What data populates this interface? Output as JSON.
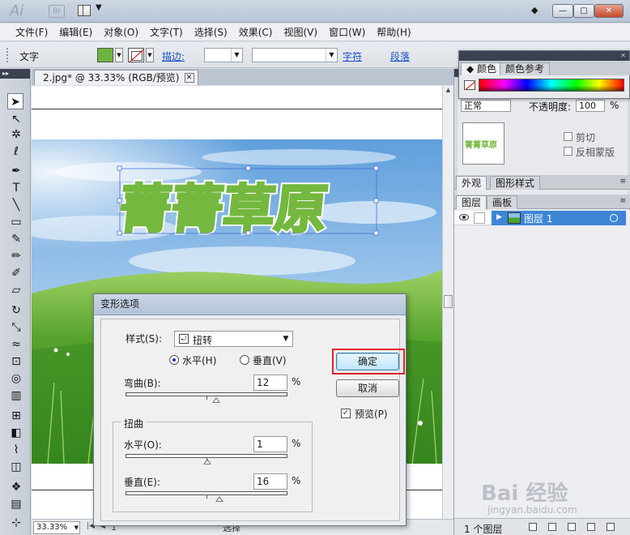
{
  "window": {
    "app_logo": "Ai",
    "bridge_badge": "Br",
    "buttons": [
      "—",
      "□",
      "✕"
    ]
  },
  "menu": [
    "文件(F)",
    "编辑(E)",
    "对象(O)",
    "文字(T)",
    "选择(S)",
    "效果(C)",
    "视图(V)",
    "窗口(W)",
    "帮助(H)"
  ],
  "control_bar": {
    "mode_label": "文字",
    "fill_color": "#6db33f",
    "stroke_label": "描边:",
    "char_link": "字符",
    "para_link": "段落"
  },
  "document": {
    "tab_title": "2.jpg* @ 33.33% (RGB/预览)",
    "close": "✕",
    "artwork_text": "菁菁草原",
    "artwork_stroke_color": "#74b83f"
  },
  "status": {
    "zoom": "33.33%",
    "page": "1",
    "tool": "选择"
  },
  "dialog": {
    "title": "变形选项",
    "style_label": "样式(S):",
    "style_value": "扭转",
    "horizontal_label": "水平(H)",
    "vertical_label": "垂直(V)",
    "orientation": "horizontal",
    "bend_label": "弯曲(B):",
    "bend_value": "12",
    "bend_percent": 12,
    "percent": "%",
    "distortion_group": "扭曲",
    "dist_h_label": "水平(O):",
    "dist_h_value": "1",
    "dist_h_percent": 1,
    "dist_v_label": "垂直(E):",
    "dist_v_value": "16",
    "dist_v_percent": 16,
    "ok": "确定",
    "cancel": "取消",
    "preview_label": "预览(P)",
    "preview_checked": true
  },
  "color_panel": {
    "tab_color": "颜色",
    "tab_guide": "颜色参考"
  },
  "transparency_panel": {
    "blend_mode": "正常",
    "opacity_label": "不透明度:",
    "opacity_value": "100",
    "percent": "%",
    "clip_label": "剪切",
    "invert_label": "反相蒙版",
    "thumb_text": "菁菁草原"
  },
  "appearance_tabs": [
    "外观",
    "图形样式"
  ],
  "layers_tabs": [
    "图层",
    "画板"
  ],
  "layers": [
    {
      "name": "图层 1"
    }
  ],
  "layers_footer": "1 个图层",
  "watermark": {
    "logo": "Bai 经验",
    "url": "jingyan.baidu.com"
  }
}
